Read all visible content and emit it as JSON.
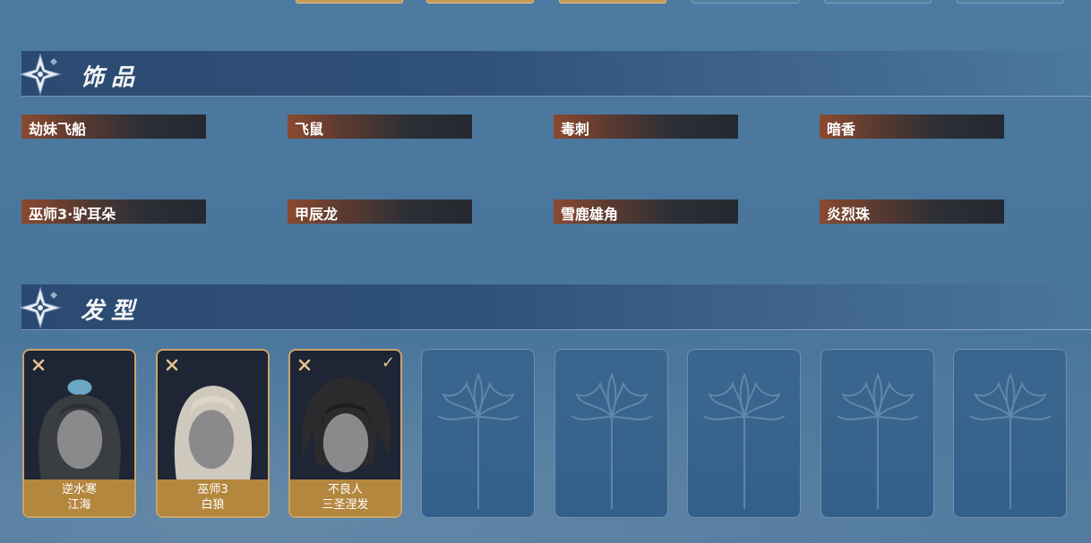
{
  "sections": {
    "accessories": {
      "title": "饰品",
      "emblem_icon": "diamond-star-icon"
    },
    "hairstyles": {
      "title": "发型",
      "emblem_icon": "diamond-star-icon"
    }
  },
  "accessories": [
    {
      "name": "劫妹飞船"
    },
    {
      "name": "飞鼠"
    },
    {
      "name": "毒刺"
    },
    {
      "name": "暗香"
    },
    {
      "name": "巫师3·驴耳朵"
    },
    {
      "name": "甲辰龙"
    },
    {
      "name": "雪鹿雄角"
    },
    {
      "name": "炎烈珠"
    }
  ],
  "hairstyles": [
    {
      "line1": "逆水寒",
      "line2": "江海",
      "hair_color": "#3a3d42",
      "selected": false
    },
    {
      "line1": "巫师3",
      "line2": "白狼",
      "hair_color": "#cfc9bd",
      "selected": false
    },
    {
      "line1": "不良人",
      "line2": "三圣涅发",
      "hair_color": "#2b2a2c",
      "selected": true
    }
  ],
  "empty_slot_icon": "spider-lily-icon",
  "colors": {
    "gold": "#b4873f",
    "gold_border": "#c9a46a",
    "panel": "#2f5078",
    "background": "#4a769c"
  }
}
